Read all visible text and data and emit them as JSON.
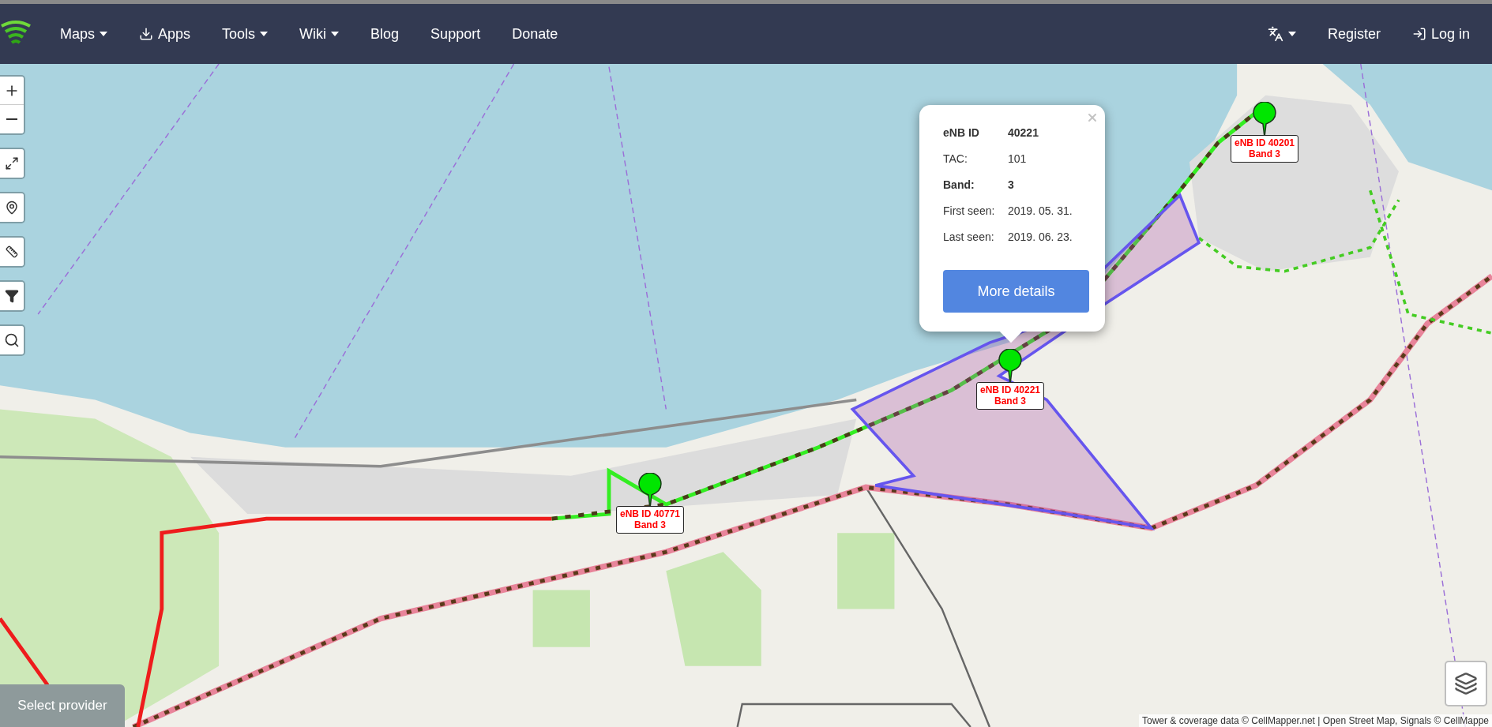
{
  "navbar": {
    "left": [
      {
        "label": "Maps",
        "kind": "dropdown"
      },
      {
        "label": "Apps",
        "kind": "download"
      },
      {
        "label": "Tools",
        "kind": "dropdown"
      },
      {
        "label": "Wiki",
        "kind": "dropdown"
      },
      {
        "label": "Blog",
        "kind": "plain"
      },
      {
        "label": "Support",
        "kind": "plain"
      },
      {
        "label": "Donate",
        "kind": "plain"
      }
    ],
    "right": [
      {
        "label": "Register",
        "kind": "plain"
      },
      {
        "label": "Log in",
        "kind": "login"
      }
    ]
  },
  "popup": {
    "rows": [
      {
        "label": "eNB ID",
        "value": "40221",
        "bold": true
      },
      {
        "label": "TAC:",
        "value": "101",
        "bold": false
      },
      {
        "label": "Band:",
        "value": "3",
        "bold": true
      },
      {
        "label": "First seen:",
        "value": "2019. 05. 31.",
        "bold": false
      },
      {
        "label": "Last seen:",
        "value": "2019. 06. 23.",
        "bold": false
      }
    ],
    "button": "More details"
  },
  "markers": [
    {
      "id_text": "eNB ID 40201",
      "band": "Band 3"
    },
    {
      "id_text": "eNB ID 40221",
      "band": "Band 3"
    },
    {
      "id_text": "eNB ID 40771",
      "band": "Band 3"
    }
  ],
  "provider_button": "Select provider",
  "attribution": "Tower & coverage data © CellMapper.net | Open Street Map, Signals © CellMappe"
}
